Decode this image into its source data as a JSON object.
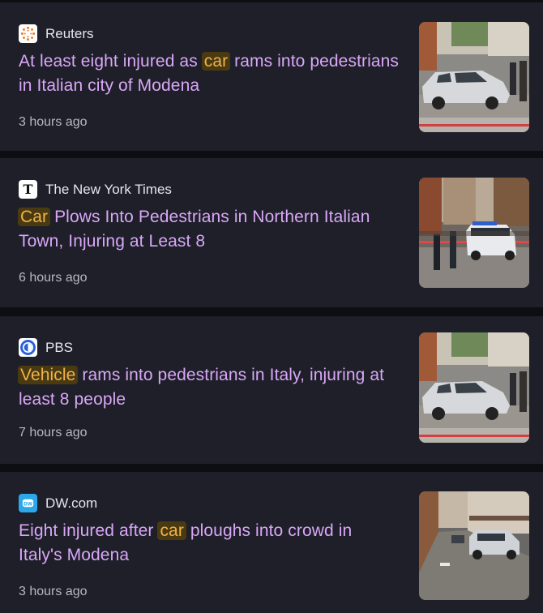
{
  "articles": [
    {
      "source": "Reuters",
      "icon": "reuters-logo-icon",
      "headline_parts": [
        {
          "text": "At least eight injured as ",
          "highlight": false
        },
        {
          "text": "car",
          "highlight": true
        },
        {
          "text": " rams into pedestrians in Italian city of Modena",
          "highlight": false
        }
      ],
      "time": "3 hours ago"
    },
    {
      "source": "The New York Times",
      "icon": "nyt-logo-icon",
      "headline_parts": [
        {
          "text": "Car",
          "highlight": true
        },
        {
          "text": " Plows Into Pedestrians in Northern Italian Town, Injuring at Least 8",
          "highlight": false
        }
      ],
      "time": "6 hours ago"
    },
    {
      "source": "PBS",
      "icon": "pbs-logo-icon",
      "headline_parts": [
        {
          "text": "Vehicle",
          "highlight": true
        },
        {
          "text": " rams into pedestrians in Italy, injuring at least 8 people",
          "highlight": false
        }
      ],
      "time": "7 hours ago"
    },
    {
      "source": "DW.com",
      "icon": "dw-logo-icon",
      "headline_parts": [
        {
          "text": "Eight injured after ",
          "highlight": false
        },
        {
          "text": "car",
          "highlight": true
        },
        {
          "text": " ploughs into crowd in Italy's Modena",
          "highlight": false
        }
      ],
      "time": "3 hours ago"
    }
  ],
  "colors": {
    "card_bg": "#1e1f29",
    "headline": "#d9a7f7",
    "highlight_bg": "#4a3a12",
    "highlight_text": "#f0b248",
    "source_text": "#e6e6ec",
    "time_text": "#b7b8c2"
  }
}
